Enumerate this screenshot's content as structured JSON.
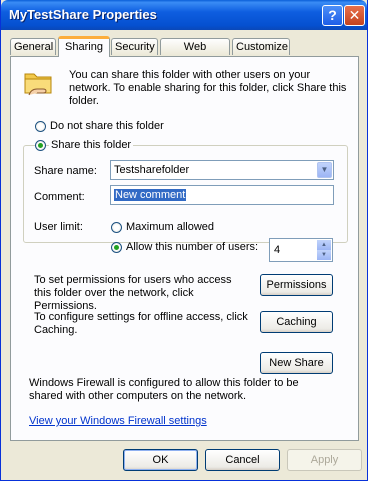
{
  "window": {
    "title": "MyTestShare Properties"
  },
  "tabs": [
    {
      "label": "General"
    },
    {
      "label": "Sharing"
    },
    {
      "label": "Security"
    },
    {
      "label": "Web Sharing"
    },
    {
      "label": "Customize"
    }
  ],
  "active_tab": "Sharing",
  "sharing": {
    "intro_text": "You can share this folder with other users on your network. To enable sharing for this folder, click Share this folder.",
    "do_not_share_label": "Do not share this folder",
    "share_this_label": "Share this folder",
    "share_selected": true,
    "share_name_label": "Share name:",
    "share_name_value": "Testsharefolder",
    "comment_label": "Comment:",
    "comment_value": "New comment",
    "user_limit_label": "User limit:",
    "maximum_allowed_label": "Maximum allowed",
    "allow_number_label": "Allow this number of users:",
    "allow_number_selected": true,
    "user_count": "4",
    "permissions_text": "To set permissions for users who access this folder over the network, click Permissions.",
    "permissions_button": "Permissions",
    "caching_text": "To configure settings for offline access, click Caching.",
    "caching_button": "Caching",
    "new_share_button": "New Share",
    "firewall_text": "Windows Firewall is configured to allow this folder to be shared with other computers on the network.",
    "firewall_link": "View your Windows Firewall settings"
  },
  "footer": {
    "ok": "OK",
    "cancel": "Cancel",
    "apply": "Apply"
  },
  "icons": [
    "help-icon",
    "close-icon",
    "folder-share-icon"
  ]
}
